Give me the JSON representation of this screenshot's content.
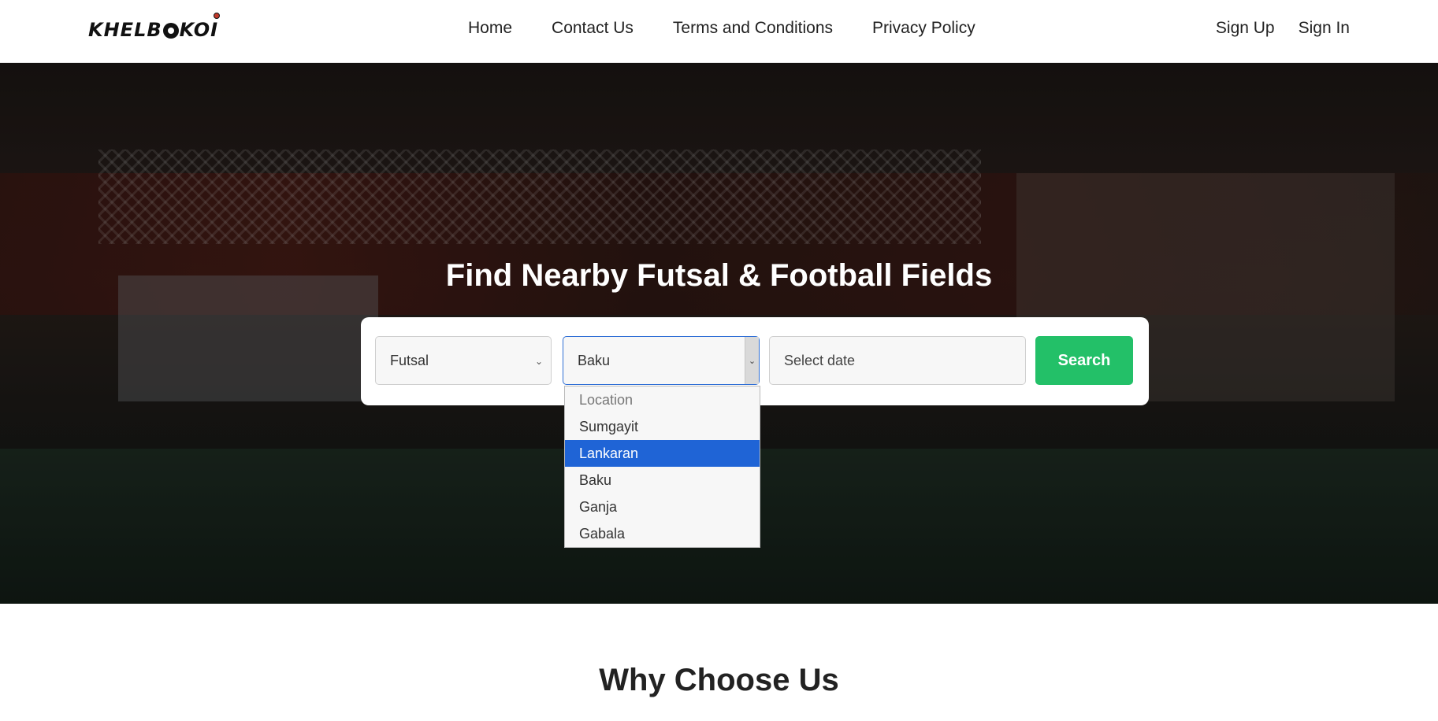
{
  "brand": {
    "logo_text_a": "KHELB",
    "logo_text_b": "KOI"
  },
  "nav": {
    "links": [
      "Home",
      "Contact Us",
      "Terms and Conditions",
      "Privacy Policy"
    ],
    "auth": [
      "Sign Up",
      "Sign In"
    ]
  },
  "hero": {
    "title": "Find Nearby Futsal & Football Fields",
    "sport_select": {
      "value": "Futsal"
    },
    "location_select": {
      "value": "Baku",
      "options": [
        "Location",
        "Sumgayit",
        "Lankaran",
        "Baku",
        "Ganja",
        "Gabala"
      ],
      "highlighted": "Lankaran"
    },
    "date_input": {
      "placeholder": "Select date"
    },
    "search_button": "Search"
  },
  "section": {
    "why_title": "Why Choose Us"
  },
  "colors": {
    "accent_green": "#23c068",
    "highlight_blue": "#1f64d6"
  }
}
